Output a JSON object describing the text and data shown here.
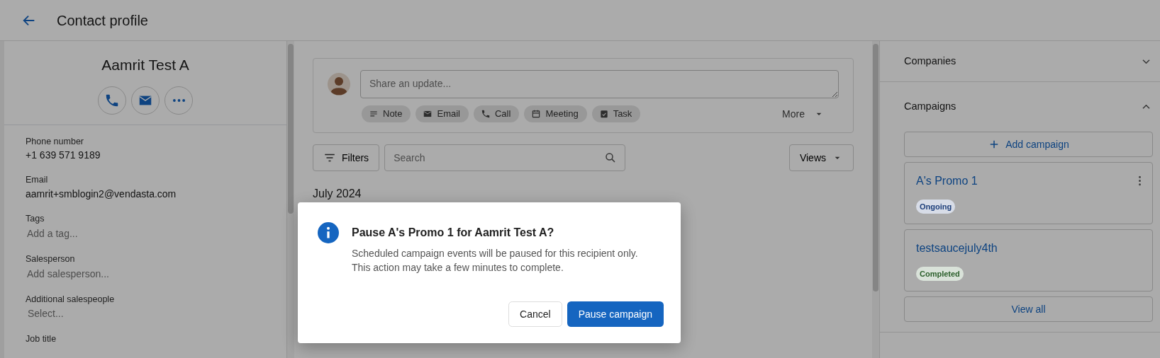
{
  "header": {
    "title": "Contact profile"
  },
  "contact": {
    "name": "Aamrit Test A",
    "actions": [
      {
        "kind": "phone"
      },
      {
        "kind": "email"
      },
      {
        "kind": "more"
      }
    ],
    "fields": [
      {
        "label": "Phone number",
        "value": "+1 639 571 9189"
      },
      {
        "label": "Email",
        "value": "aamrit+smblogin2@vendasta.com"
      },
      {
        "label": "Tags",
        "placeholder": "Add a tag..."
      },
      {
        "label": "Salesperson",
        "placeholder": "Add salesperson..."
      },
      {
        "label": "Additional salespeople",
        "placeholder": "Select..."
      },
      {
        "label": "Job title"
      }
    ]
  },
  "composer": {
    "placeholder": "Share an update...",
    "chips": [
      {
        "label": "Note",
        "kind": "note"
      },
      {
        "label": "Email",
        "kind": "email"
      },
      {
        "label": "Call",
        "kind": "call"
      },
      {
        "label": "Meeting",
        "kind": "meeting"
      },
      {
        "label": "Task",
        "kind": "task"
      }
    ],
    "more": "More"
  },
  "toolbar": {
    "filters": "Filters",
    "search_placeholder": "Search",
    "views": "Views"
  },
  "timeline": {
    "month": "July 2024"
  },
  "sidebar": {
    "sections": [
      {
        "title": "Companies",
        "expanded": false
      },
      {
        "title": "Campaigns",
        "expanded": true,
        "add_button": "Add campaign",
        "campaigns": [
          {
            "name": "A's Promo 1",
            "status": "Ongoing",
            "color": "#1e3f7a",
            "menu": true
          },
          {
            "name": "testsaucejuly4th",
            "status": "Completed",
            "color": "#2a5e2a",
            "menu": false
          }
        ],
        "view_all": "View all"
      }
    ]
  },
  "dialog": {
    "title": "Pause A's Promo 1 for Aamrit Test A?",
    "message": [
      "Scheduled campaign events will be paused for this recipient only.",
      "This action may take a few minutes to complete."
    ],
    "buttons": [
      {
        "label": "Cancel",
        "kind": "secondary"
      },
      {
        "label": "Pause campaign",
        "kind": "primary"
      }
    ]
  }
}
